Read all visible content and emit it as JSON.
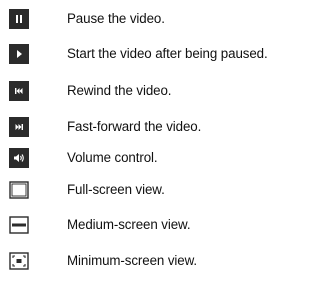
{
  "legend": {
    "items": [
      {
        "icon": "pause-icon",
        "label": "Pause the video."
      },
      {
        "icon": "play-icon",
        "label": "Start the video after being paused."
      },
      {
        "icon": "rewind-icon",
        "label": "Rewind the video."
      },
      {
        "icon": "fast-forward-icon",
        "label": "Fast-forward the video."
      },
      {
        "icon": "volume-icon",
        "label": "Volume control."
      },
      {
        "icon": "full-screen-icon",
        "label": "Full-screen view."
      },
      {
        "icon": "medium-screen-icon",
        "label": "Medium-screen view."
      },
      {
        "icon": "minimum-screen-icon",
        "label": "Minimum-screen view."
      }
    ],
    "colors": {
      "icon_fill": "#2b2b2b",
      "icon_glyph": "#ffffff",
      "outline": "#2b2b2b",
      "text": "#111111"
    }
  }
}
